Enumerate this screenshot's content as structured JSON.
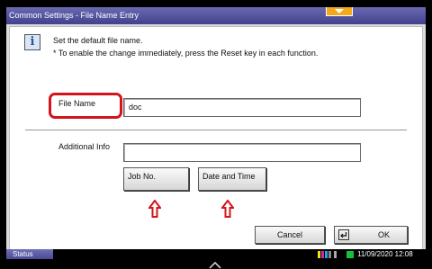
{
  "window": {
    "title": "Common Settings - File Name Entry"
  },
  "info": {
    "line1": "Set the default file name.",
    "line2": "* To enable the change immediately, press the Reset key in each function."
  },
  "file_name": {
    "label": "File Name",
    "value": "doc"
  },
  "additional_info": {
    "label": "Additional Info",
    "value": ""
  },
  "buttons": {
    "job_no": "Job No.",
    "date_time": "Date and Time",
    "cancel": "Cancel",
    "ok": "OK"
  },
  "status_bar": {
    "status_label": "Status",
    "datetime": "11/09/2020  12:08"
  },
  "colors": {
    "title_bar": "#41418e",
    "highlight": "#d3141c",
    "tab_accent": "#f4a81c"
  }
}
